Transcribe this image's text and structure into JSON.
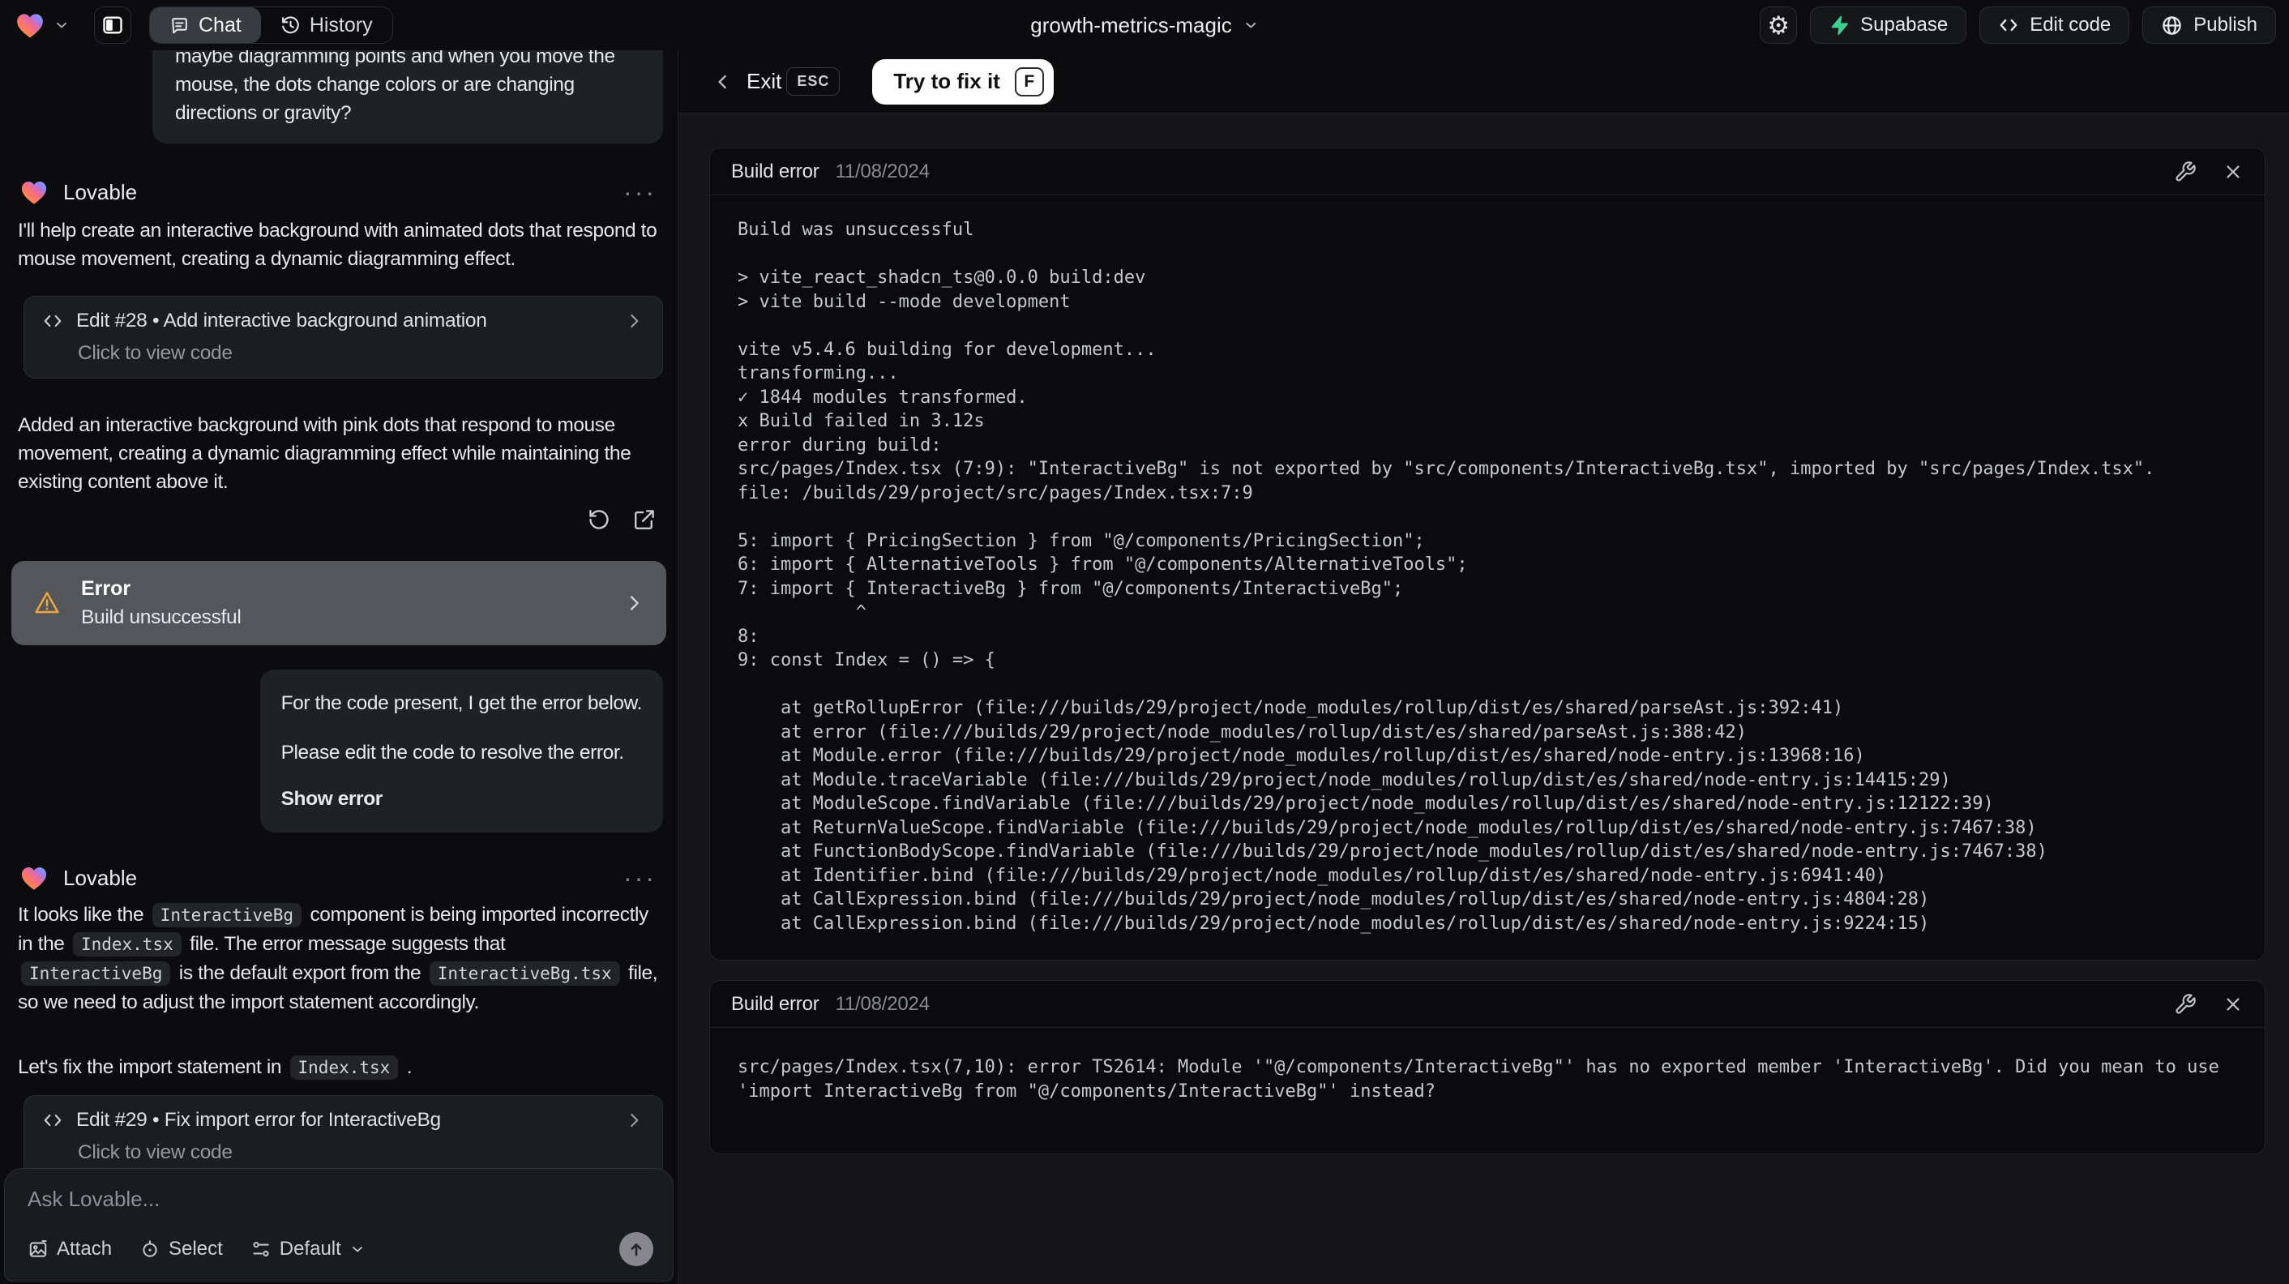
{
  "topbar": {
    "project": {
      "name": "growth-metrics-magic"
    },
    "tabs": {
      "chat": "Chat",
      "history": "History"
    },
    "buttons": {
      "supabase": "Supabase",
      "edit_code": "Edit code",
      "publish": "Publish"
    }
  },
  "chat": {
    "assistant_name": "Lovable",
    "more_menu": "···",
    "user_message_1": "maybe diagramming points and when you move the mouse, the dots change colors or are changing directions or gravity?",
    "assistant_intro": "I'll help create an interactive background with animated dots that respond to mouse movement, creating a dynamic diagramming effect.",
    "edit_card_28": {
      "title": "Edit #28 • Add interactive background animation",
      "subtitle": "Click to view code"
    },
    "assistant_summary": "Added an interactive background with pink dots that respond to mouse movement, creating a dynamic diagramming effect while maintaining the existing content above it.",
    "error_card": {
      "title": "Error",
      "subtitle": "Build unsuccessful"
    },
    "user_message_2": {
      "line1": "For the code present, I get the error below.",
      "line2": "Please edit the code to resolve the error.",
      "action": "Show error"
    },
    "assistant_fix_p1": [
      {
        "t": "It looks like the "
      },
      {
        "c": "InteractiveBg"
      },
      {
        "t": " component is being imported incorrectly in the "
      },
      {
        "c": "Index.tsx"
      },
      {
        "t": " file. The error message suggests that "
      },
      {
        "c": "InteractiveBg"
      },
      {
        "t": " is the default export from the "
      },
      {
        "c": "InteractiveBg.tsx"
      },
      {
        "t": " file, so we need to adjust the import statement accordingly."
      }
    ],
    "assistant_fix_p2": [
      {
        "t": "Let's fix the import statement in "
      },
      {
        "c": "Index.tsx"
      },
      {
        "t": " ."
      }
    ],
    "edit_card_29": {
      "title": "Edit #29 • Fix import error for InteractiveBg",
      "subtitle": "Click to view code"
    },
    "composer": {
      "placeholder": "Ask Lovable...",
      "attach": "Attach",
      "select": "Select",
      "mode": "Default"
    }
  },
  "overlay": {
    "exit": "Exit",
    "esc": "ESC",
    "fix": "Try to fix it",
    "fix_key": "F",
    "card1": {
      "title": "Build error",
      "date": "11/08/2024",
      "log": "Build was unsuccessful\n\n> vite_react_shadcn_ts@0.0.0 build:dev\n> vite build --mode development\n\nvite v5.4.6 building for development...\ntransforming...\n✓ 1844 modules transformed.\nx Build failed in 3.12s\nerror during build:\nsrc/pages/Index.tsx (7:9): \"InteractiveBg\" is not exported by \"src/components/InteractiveBg.tsx\", imported by \"src/pages/Index.tsx\".\nfile: /builds/29/project/src/pages/Index.tsx:7:9\n\n5: import { PricingSection } from \"@/components/PricingSection\";\n6: import { AlternativeTools } from \"@/components/AlternativeTools\";\n7: import { InteractiveBg } from \"@/components/InteractiveBg\";\n           ^\n8: \n9: const Index = () => {\n\n    at getRollupError (file:///builds/29/project/node_modules/rollup/dist/es/shared/parseAst.js:392:41)\n    at error (file:///builds/29/project/node_modules/rollup/dist/es/shared/parseAst.js:388:42)\n    at Module.error (file:///builds/29/project/node_modules/rollup/dist/es/shared/node-entry.js:13968:16)\n    at Module.traceVariable (file:///builds/29/project/node_modules/rollup/dist/es/shared/node-entry.js:14415:29)\n    at ModuleScope.findVariable (file:///builds/29/project/node_modules/rollup/dist/es/shared/node-entry.js:12122:39)\n    at ReturnValueScope.findVariable (file:///builds/29/project/node_modules/rollup/dist/es/shared/node-entry.js:7467:38)\n    at FunctionBodyScope.findVariable (file:///builds/29/project/node_modules/rollup/dist/es/shared/node-entry.js:7467:38)\n    at Identifier.bind (file:///builds/29/project/node_modules/rollup/dist/es/shared/node-entry.js:6941:40)\n    at CallExpression.bind (file:///builds/29/project/node_modules/rollup/dist/es/shared/node-entry.js:4804:28)\n    at CallExpression.bind (file:///builds/29/project/node_modules/rollup/dist/es/shared/node-entry.js:9224:15)"
    },
    "card2": {
      "title": "Build error",
      "date": "11/08/2024",
      "log": "src/pages/Index.tsx(7,10): error TS2614: Module '\"@/components/InteractiveBg\"' has no exported member 'InteractiveBg'. Did you mean to use 'import InteractiveBg from \"@/components/InteractiveBg\"' instead?"
    }
  },
  "colors": {
    "supabase_green": "#3ecf8e",
    "warning_yellow": "#e9a53f"
  }
}
